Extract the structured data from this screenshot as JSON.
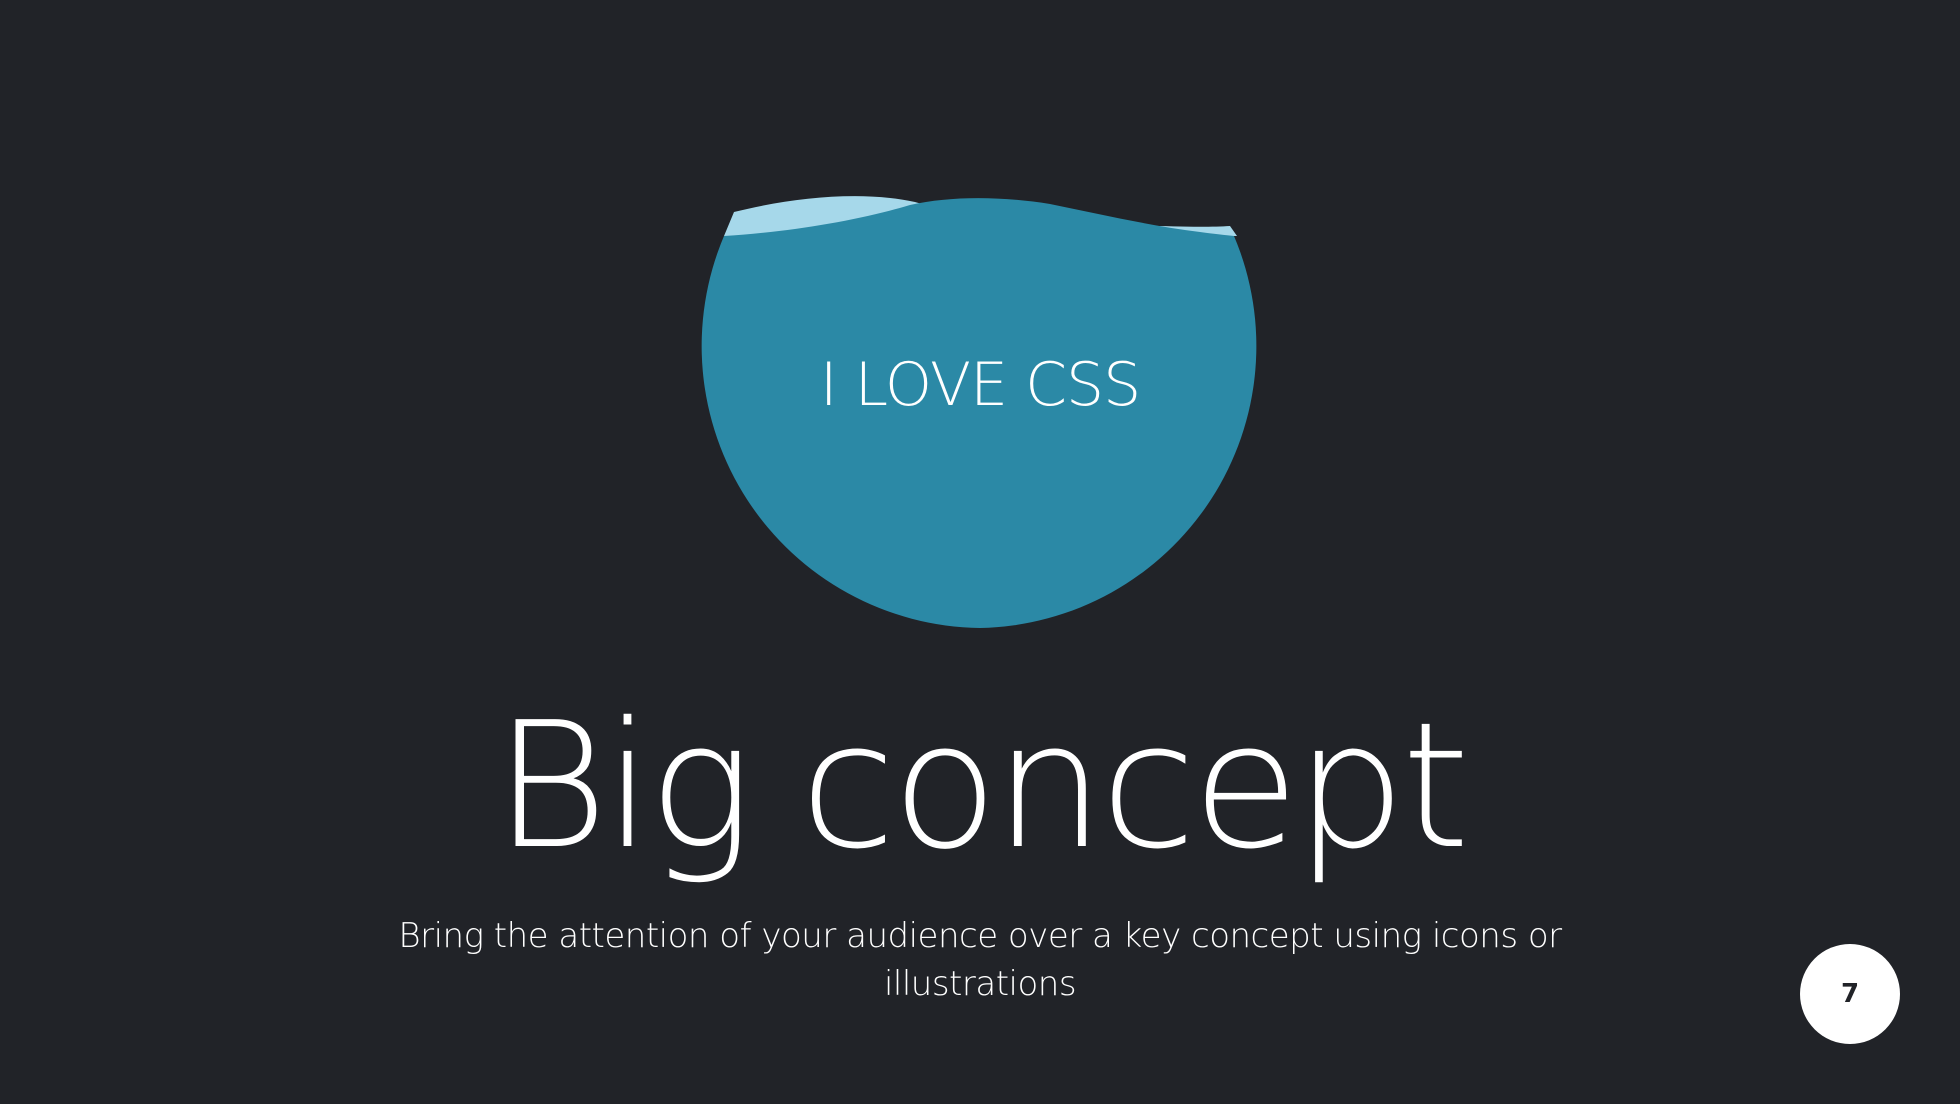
{
  "slide": {
    "circle_text": "I LOVE CSS",
    "title": "Big concept",
    "subtitle": "Bring the attention of your audience over a key concept using icons or illustrations",
    "page_number": "7"
  },
  "colors": {
    "background": "#212328",
    "circle_fill": "#2b89a6",
    "wave_highlight": "#a6d8ea",
    "text": "#ffffff",
    "badge_fill": "#ffffff",
    "badge_text": "#212328"
  }
}
